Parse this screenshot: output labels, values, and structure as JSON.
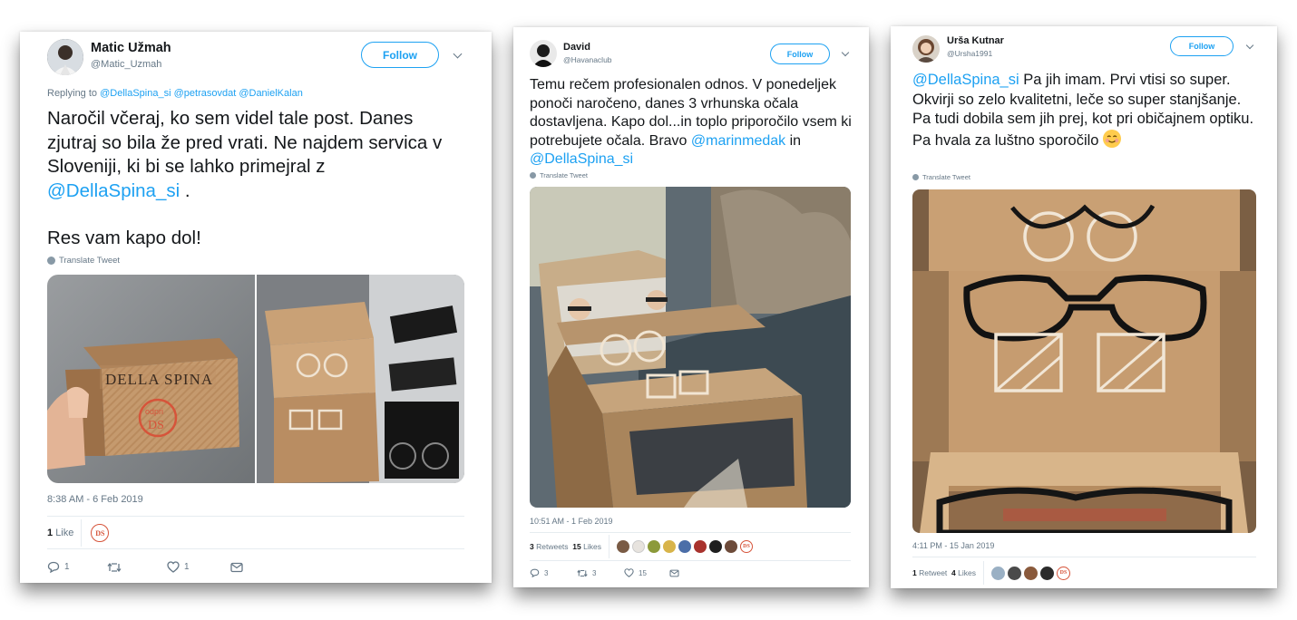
{
  "colors": {
    "link": "#1da1f2",
    "muted": "#657786",
    "text": "#14171a",
    "brand_red": "#d6543a"
  },
  "tweets": [
    {
      "name": "Matic Užmah",
      "handle": "@Matic_Uzmah",
      "follow_label": "Follow",
      "replying_prefix": "Replying to",
      "replying_to": [
        "@DellaSpina_si",
        "@petrasovdat",
        "@DanielKalan"
      ],
      "text_part1": "Naročil včeraj, ko sem videl tale post. Danes zjutraj so bila že pred vrati. Ne najdem servica v Sloveniji, ki bi se lahko primejral z",
      "text_mention": "@DellaSpina_si",
      "text_part2": " .",
      "text_line2": "Res vam kapo dol!",
      "translate_label": "Translate Tweet",
      "box_logo": "DELLA SPINA",
      "box_stamp": "odpri",
      "timestamp": "8:38 AM - 6 Feb 2019",
      "likes_count": "1",
      "likes_label": "Like",
      "liker_badge": "DS",
      "reply_count": "1",
      "retweet_count": "",
      "like_count": "1"
    },
    {
      "name": "David",
      "handle": "@Havanaclub",
      "follow_label": "Follow",
      "text_part1": "Temu rečem profesionalen odnos. V ponedeljek ponoči naročeno, danes 3 vrhunska očala dostavljena. Kapo dol...in toplo priporočilo vsem ki potrebujete očala. Bravo ",
      "mention1": "@marinmedak",
      "text_mid": " in ",
      "mention2": "@DellaSpina_si",
      "translate_label": "Translate Tweet",
      "timestamp": "10:51 AM - 1 Feb 2019",
      "retweets_count": "3",
      "retweets_label": "Retweets",
      "likes_count": "15",
      "likes_label": "Likes",
      "liker_badge": "DS",
      "reply_count": "3",
      "retweet_count": "3",
      "like_count": "15"
    },
    {
      "name": "Urša Kutnar",
      "handle": "@Ursha1991",
      "follow_label": "Follow",
      "mention": "@DellaSpina_si",
      "text": " Pa jih imam. Prvi vtisi so super. Okvirji so zelo kvalitetni, leče so super stanjšanje. Pa tudi dobila sem jih prej, kot pri običajnem optiku. Pa hvala za luštno sporočilo",
      "translate_label": "Translate Tweet",
      "timestamp": "4:11 PM - 15 Jan 2019",
      "retweets_count": "1",
      "retweets_label": "Retweet",
      "likes_count": "4",
      "likes_label": "Likes",
      "liker_badge": "DS"
    }
  ]
}
